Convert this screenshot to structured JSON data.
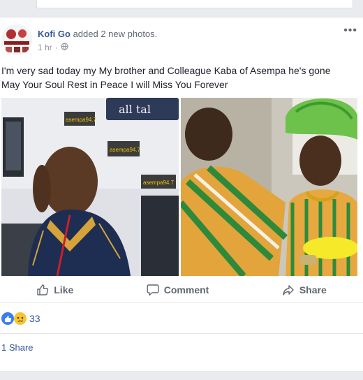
{
  "post": {
    "author": "Kofi Go",
    "action_text": "added 2 new photos.",
    "time": "1 hr",
    "privacy_icon": "globe-icon",
    "more_label": "•••",
    "text_line1": "I'm very sad today my My brother and Colleague Kaba of Asempa he's gone",
    "text_line2": "May Your Soul Rest in Peace I will Miss You Forever"
  },
  "photos": {
    "left_sign_top": "all tal",
    "left_sign_logo1": "asempa94.7",
    "left_sign_logo2": "asempa94.7",
    "left_sign_logo3": "asempa94.7"
  },
  "actions": {
    "like_label": "Like",
    "comment_label": "Comment",
    "share_label": "Share"
  },
  "reactions": {
    "count": "33",
    "icons": [
      "like-icon",
      "sad-icon"
    ]
  },
  "shares": {
    "label": "1 Share"
  },
  "colors": {
    "link_blue": "#365899",
    "action_gray": "#606770",
    "meta_gray": "#90949c",
    "background": "#e9ebee"
  }
}
